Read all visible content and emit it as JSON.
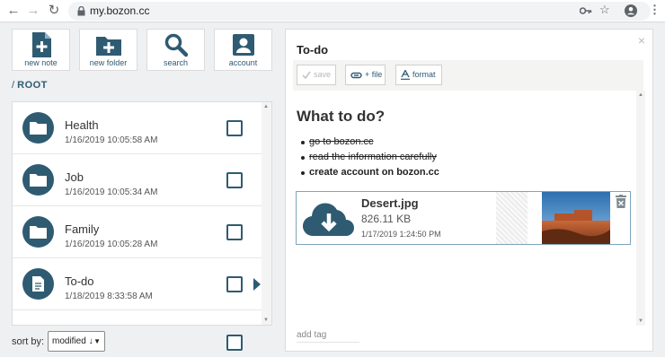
{
  "browser": {
    "url": "my.bozon.cc",
    "back_icon": "←",
    "forward_icon": "→",
    "reload_icon": "↻",
    "key_icon": "key-icon",
    "star_icon": "☆",
    "account_icon": "account-circle-icon",
    "menu_icon": "⋮"
  },
  "toolbar": {
    "new_note": "new note",
    "new_folder": "new folder",
    "search": "search",
    "account": "account"
  },
  "breadcrumb": {
    "sep": "/",
    "root": "ROOT"
  },
  "items": [
    {
      "name": "Health",
      "date": "1/16/2019 10:05:58 AM",
      "type": "folder"
    },
    {
      "name": "Job",
      "date": "1/16/2019 10:05:34 AM",
      "type": "folder"
    },
    {
      "name": "Family",
      "date": "1/16/2019 10:05:28 AM",
      "type": "folder"
    },
    {
      "name": "To-do",
      "date": "1/18/2019 8:33:58 AM",
      "type": "note"
    }
  ],
  "sort": {
    "label": "sort by:",
    "value": "modified ↓"
  },
  "panel": {
    "title": "To-do",
    "close": "×",
    "save": "save",
    "file": "+ file",
    "format": "format",
    "heading": "What to do?",
    "tasks": [
      {
        "text": "go to bozon.cc",
        "done": true
      },
      {
        "text": "read the information carefully",
        "done": true
      },
      {
        "text": "create account on bozon.cc",
        "done": false
      }
    ],
    "attachment": {
      "name": "Desert.jpg",
      "size": "826.11 KB",
      "date": "1/17/2019 1:24:50 PM"
    },
    "add_tag": "add tag"
  },
  "colors": {
    "accent": "#2f5b72",
    "background": "#eef0f1"
  }
}
